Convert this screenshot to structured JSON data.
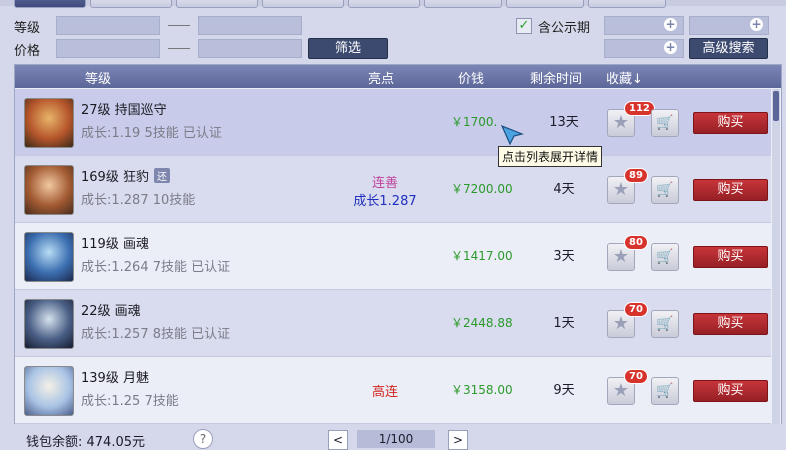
{
  "filters": {
    "level_label": "等级",
    "price_label": "价格",
    "dash": "——",
    "filter_button": "筛选",
    "public_label": "含公示期",
    "public_checked": true,
    "advanced_button": "高级搜索"
  },
  "table": {
    "headers": {
      "level": "等级",
      "highlight": "亮点",
      "price": "价钱",
      "time": "剩余时间",
      "fav": "收藏↓"
    },
    "rows": [
      {
        "name": "27级 持国巡守",
        "sub": "成长:1.19 5技能 已认证",
        "badge": "",
        "highlight1": "",
        "highlight2": "",
        "price": "￥1700.",
        "time": "13天",
        "fav": "112",
        "buy": "购买"
      },
      {
        "name": "169级 狂豹",
        "sub": "成长:1.287 10技能",
        "badge": "还",
        "highlight1": "连善",
        "highlight2": "成长1.287",
        "price": "￥7200.00",
        "time": "4天",
        "fav": "89",
        "buy": "购买"
      },
      {
        "name": "119级 画魂",
        "sub": "成长:1.264 7技能 已认证",
        "badge": "",
        "highlight1": "",
        "highlight2": "",
        "price": "￥1417.00",
        "time": "3天",
        "fav": "80",
        "buy": "购买"
      },
      {
        "name": "22级 画魂",
        "sub": "成长:1.257 8技能 已认证",
        "badge": "",
        "highlight1": "",
        "highlight2": "",
        "price": "￥2448.88",
        "time": "1天",
        "fav": "70",
        "buy": "购买"
      },
      {
        "name": "139级 月魅",
        "sub": "成长:1.25 7技能",
        "badge": "",
        "highlight1": "高连",
        "highlight2": "",
        "price": "￥3158.00",
        "time": "9天",
        "fav": "70",
        "buy": "购买"
      }
    ]
  },
  "tooltip": "点击列表展开详情",
  "footer": {
    "wallet": "钱包余额: 474.05元",
    "help": "?",
    "prev": "<",
    "page": "1/100",
    "next": ">"
  },
  "colors": {
    "accent": "#3c4a70",
    "buy": "#b12a30",
    "price": "#2a9a2a",
    "badge": "#d8322c"
  }
}
